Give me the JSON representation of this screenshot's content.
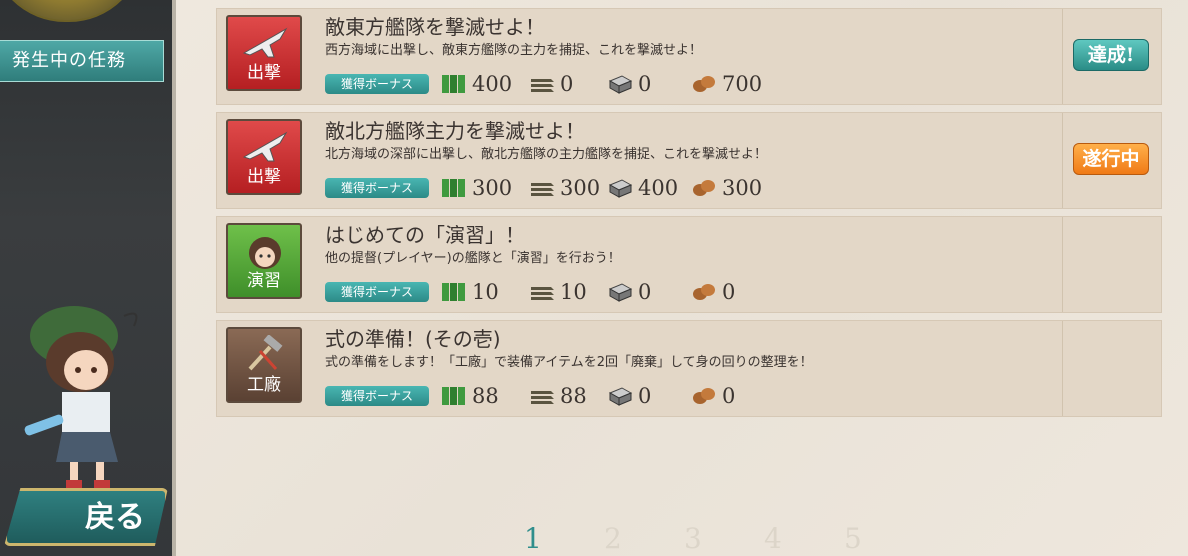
{
  "sidebar": {
    "active_tab": "発生中の任務"
  },
  "back_button": {
    "label": "戻る"
  },
  "bonus_label": "獲得ボーナス",
  "quests": [
    {
      "category": "出撃",
      "title": "敵東方艦隊を撃滅せよ！",
      "description": "西方海域に出撃し、敵東方艦隊の主力を捕捉、これを撃滅せよ！",
      "rewards": {
        "fuel": "400",
        "ammo": "0",
        "steel": "0",
        "bauxite": "700"
      },
      "status": "達成!"
    },
    {
      "category": "出撃",
      "title": "敵北方艦隊主力を撃滅せよ！",
      "description": "北方海域の深部に出撃し、敵北方艦隊の主力艦隊を捕捉、これを撃滅せよ！",
      "rewards": {
        "fuel": "300",
        "ammo": "300",
        "steel": "400",
        "bauxite": "300"
      },
      "status": "遂行中"
    },
    {
      "category": "演習",
      "title": "はじめての「演習」！",
      "description": "他の提督(プレイヤー)の艦隊と「演習」を行おう！",
      "rewards": {
        "fuel": "10",
        "ammo": "10",
        "steel": "0",
        "bauxite": "0"
      },
      "status": ""
    },
    {
      "category": "工廠",
      "title": "式の準備！(その壱)",
      "description": "式の準備をします！「工廠」で装備アイテムを2回「廃棄」して身の回りの整理を！",
      "rewards": {
        "fuel": "88",
        "ammo": "88",
        "steel": "0",
        "bauxite": "0"
      },
      "status": ""
    }
  ],
  "pagination": {
    "pages": [
      "1",
      "2",
      "3",
      "4",
      "5"
    ],
    "current": "1"
  },
  "colors": {
    "accent_teal": "#2f8e8c",
    "sortie_red": "#c52a2c",
    "exercise_green": "#4f9f35",
    "arsenal_brown": "#6b4f3d",
    "done_teal": "#2a8c86",
    "progress_orange": "#f07a16"
  }
}
